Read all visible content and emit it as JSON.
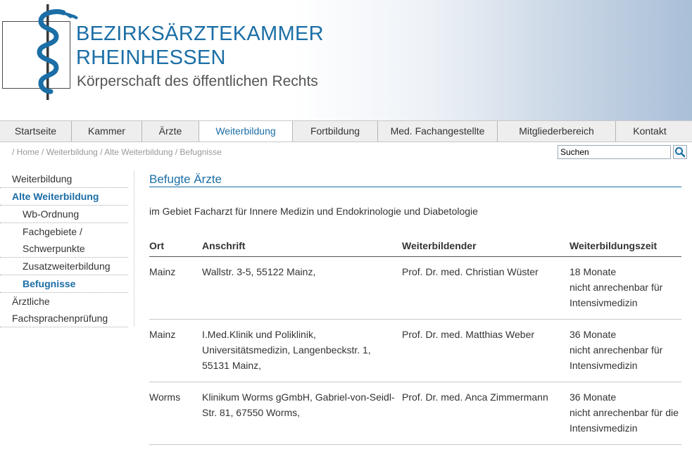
{
  "header": {
    "brand_line1": "BEZIRKSÄRZTEKAMMER",
    "brand_line2": "RHEINHESSEN",
    "brand_subtitle": "Körperschaft des öffentlichen Rechts"
  },
  "colors": {
    "accent": "#1b6ea6",
    "nav_bg": "#eeeeee"
  },
  "nav": {
    "items": [
      {
        "label": "Startseite"
      },
      {
        "label": "Kammer"
      },
      {
        "label": "Ärzte"
      },
      {
        "label": "Weiterbildung"
      },
      {
        "label": "Fortbildung"
      },
      {
        "label": "Med. Fachangestellte"
      },
      {
        "label": "Mitgliederbereich"
      },
      {
        "label": "Kontakt"
      }
    ],
    "active": "Weiterbildung"
  },
  "breadcrumb": [
    "/ Home",
    "/ Weiterbildung",
    "/ Alte Weiterbildung",
    "/ Befugnisse"
  ],
  "search": {
    "value": "Suchen",
    "button_icon": "search-icon"
  },
  "sidebar": {
    "items": [
      {
        "label": "Weiterbildung"
      },
      {
        "label": "Alte Weiterbildung"
      },
      {
        "label": "Wb-Ordnung"
      },
      {
        "label": "Fachgebiete /"
      },
      {
        "label": "Schwerpunkte"
      },
      {
        "label": "Zusatzweiterbildung"
      },
      {
        "label": "Befugnisse"
      },
      {
        "label": "Ärztliche"
      },
      {
        "label": "Fachsprachenprüfung"
      }
    ]
  },
  "main": {
    "title": "Befugte Ärzte",
    "intro": "im Gebiet Facharzt für Innere Medizin und Endokrinologie und Diabetologie",
    "table": {
      "headers": [
        "Ort",
        "Anschrift",
        "Weiterbildender",
        "Weiterbildungszeit"
      ],
      "rows": [
        {
          "ort": "Mainz",
          "anschrift": [
            "Wallstr. 3-5, 55122 Mainz,"
          ],
          "weiterbildender": "Prof. Dr. med. Christian Wüster",
          "zeit": [
            "18 Monate",
            "nicht anrechenbar für",
            "Intensivmedizin"
          ]
        },
        {
          "ort": "Mainz",
          "anschrift": [
            "I.Med.Klinik und Poliklinik,",
            "Universitätsmedizin, Langenbeckstr. 1,",
            "55131 Mainz,"
          ],
          "weiterbildender": "Prof. Dr. med. Matthias Weber",
          "zeit": [
            "36 Monate",
            "nicht anrechenbar für",
            "Intensivmedizin"
          ]
        },
        {
          "ort": "Worms",
          "anschrift": [
            "Klinikum Worms gGmbH, Gabriel-von-Seidl-",
            "Str. 81, 67550 Worms,"
          ],
          "weiterbildender": "Prof. Dr. med. Anca Zimmermann",
          "zeit": [
            "36 Monate",
            "nicht anrechenbar für die",
            "Intensivmedizin"
          ]
        }
      ]
    }
  }
}
